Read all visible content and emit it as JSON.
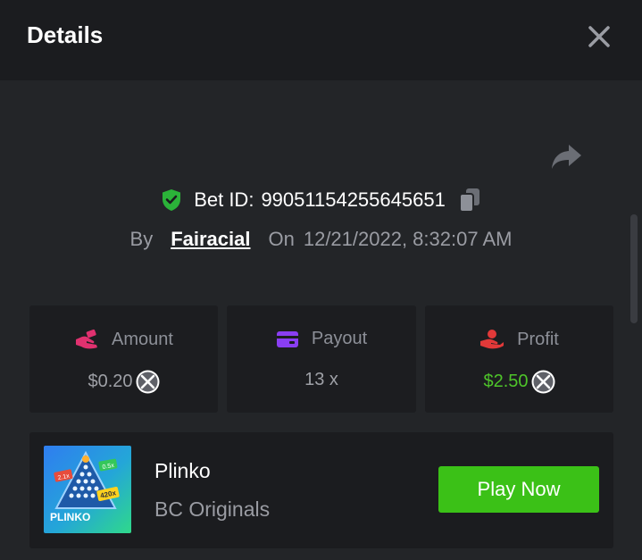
{
  "header": {
    "title": "Details"
  },
  "bet": {
    "id_label": "Bet ID:",
    "id_value": "99051154255645651",
    "by_label": "By",
    "author": "Fairacial",
    "on_label": "On",
    "datetime": "12/21/2022, 8:32:07 AM"
  },
  "stats": {
    "amount": {
      "label": "Amount",
      "value": "$0.20",
      "icon": "hand-money-icon"
    },
    "payout": {
      "label": "Payout",
      "value": "13 x",
      "icon": "card-icon"
    },
    "profit": {
      "label": "Profit",
      "value": "$2.50",
      "icon": "hand-profit-icon"
    }
  },
  "game": {
    "name": "Plinko",
    "provider": "BC Originals",
    "button": "Play Now",
    "thumb_text": "PLINKO",
    "thumb_tags": [
      "2.1x",
      "0.5x",
      "420x"
    ]
  },
  "colors": {
    "accent_green": "#3bc117",
    "profit_green": "#4ec42a",
    "amount_pink": "#e0316f",
    "payout_purple": "#8a3ef2",
    "profit_red": "#e23939",
    "verified_green": "#2bb339"
  }
}
